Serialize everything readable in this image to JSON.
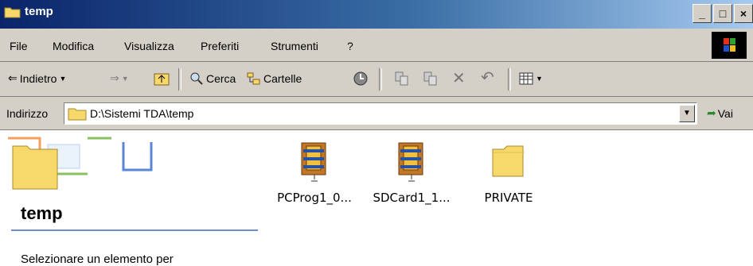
{
  "window": {
    "title": "temp"
  },
  "menu": [
    "File",
    "Modifica",
    "Visualizza",
    "Preferiti",
    "Strumenti",
    "?"
  ],
  "toolbar": {
    "back_label": "Indietro",
    "search_label": "Cerca",
    "folders_label": "Cartelle"
  },
  "address": {
    "label": "Indirizzo",
    "path": "D:\\Sistemi TDA\\temp",
    "go_label": "Vai"
  },
  "sidebar": {
    "folder_title": "temp",
    "description": "Selezionare un elemento per"
  },
  "files": [
    {
      "name": "PCProg1_0...",
      "icon": "zip-archive-icon"
    },
    {
      "name": "SDCard1_1...",
      "icon": "zip-archive-icon"
    },
    {
      "name": "PRIVATE",
      "icon": "folder-icon"
    }
  ],
  "colors": {
    "title_start": "#0a246a",
    "title_end": "#a6caf0",
    "chrome": "#d4d0c8"
  }
}
